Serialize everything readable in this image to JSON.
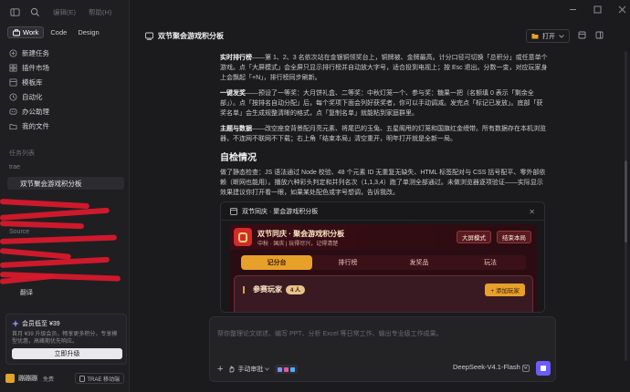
{
  "menu": {
    "edit": "编辑(E)",
    "help": "帮助(H)"
  },
  "modes": {
    "work": "Work",
    "code": "Code",
    "design": "Design"
  },
  "nav": [
    {
      "label": "新建任务",
      "icon": "new-task-icon"
    },
    {
      "label": "插件市场",
      "icon": "plugin-icon"
    },
    {
      "label": "模板库",
      "icon": "template-icon"
    },
    {
      "label": "自动化",
      "icon": "automation-icon"
    },
    {
      "label": "办公助理",
      "icon": "assistant-icon"
    },
    {
      "label": "我的文件",
      "icon": "folder-icon"
    }
  ],
  "tasks": {
    "section": "任务列表",
    "group_trae": "trae",
    "active_task": "双节聚会游戏积分板",
    "group_source": "Source",
    "last_item": "翻译"
  },
  "promo": {
    "title": "会员低至 ¥39",
    "desc": "首月 ¥39 升级会员，畅享更多积分，专享模型优惠，高峰期优先响应。",
    "button": "立即升级"
  },
  "user": {
    "name": "蹦蹦蹦",
    "plan": "免费",
    "mobile": "TRAE 移动端"
  },
  "header": {
    "title": "双节聚会游戏积分板",
    "open": "打开"
  },
  "content": {
    "p1_label": "实时排行榜",
    "p1": "——第 1、2、3 名依次站在金银铜领奖台上，铜牌被、金牌最高。计分口径可切换「总积分」或任意单个游戏。点「大屏模式」会全屏只显示排行榜并自动放大字号，适合投到电视上；按 Esc 退出。分数一变，对应玩家身上会飘起「+N」，排行榜同步刷新。",
    "p2_label": "一键发奖",
    "p2": "——预设了一等奖：大月饼礼盒、二等奖：中秋灯笼一个、参与奖：糖果一把（名额填 0 表示「剩余全部」）。点「按排名自动分配」后，每个奖项下面会列好获奖者，你可以手动调减。发完点「标记已发放」。底部「获奖名单」会生成规整清晰的格式，点「复制名单」就能粘到家庭群里。",
    "p3_label": "主题与数据",
    "p3": "——改空座变背景配月亮元素、将尾巴的玉兔、五星阁甩的灯笼和国旗红金绶带。所有数据存在本机浏览器，不连网不联网不下载；右上角「结束本局」清空重开，明年打开就是全新一局。",
    "h2": "自检情况",
    "p4": "做了静态检查：JS 语法通过 Node 校验、48 个元素 ID 无重复无缺失、HTML 标签配对与 CSS 括号配平、零外部依赖（断网也能用）。播放六种彩头判定和并列名次（1,1,3,4）跑了单测全部通过。未做浏览器逐项验证——实际显示效果建议你打开看一眼，如果某处配色或字号想调，告诉我改。"
  },
  "preview": {
    "tab_title": "双节同庆 · 聚会游戏积分板",
    "app_title": "双节同庆 · 聚会游戏积分板",
    "app_sub": "中秋 · 国庆 | 玩得尽兴，记得清楚",
    "btn_big": "大屏模式",
    "btn_end": "结束本局",
    "tabs": [
      "记分台",
      "排行榜",
      "发奖品",
      "玩法"
    ],
    "card_title": "参赛玩家",
    "card_count": "4 人",
    "add_player": "+ 添加玩家"
  },
  "composer": {
    "placeholder": "帮你整理论文综述、编写 PPT、分析 Excel 等日常工作、输出专业级工作成果。",
    "mode": "手动审批",
    "model": "DeepSeek-V4.1-Flash"
  },
  "colors": {
    "accent": "#6f5cff",
    "gold": "#e7a12a",
    "festive_red": "#d42a2a",
    "scribble": "#d7192c"
  }
}
